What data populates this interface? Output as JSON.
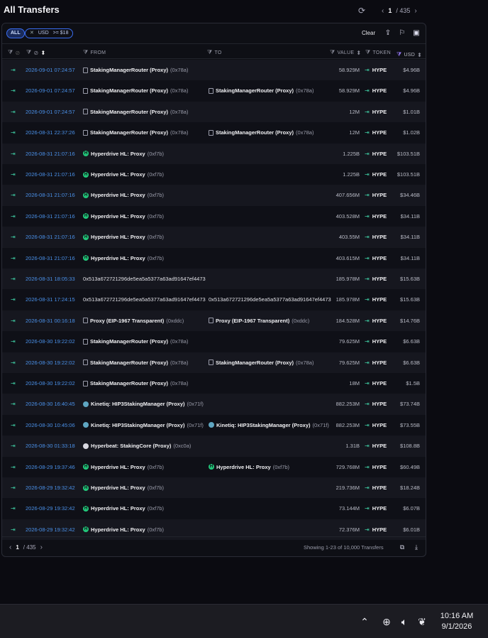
{
  "header": {
    "title": "All Transfers",
    "refresh_icon": "refresh-icon",
    "page_current": "1",
    "page_total": "/ 435"
  },
  "filters": {
    "all_label": "ALL",
    "usd_filter_label": "USD",
    "usd_filter_value": ">= $18",
    "clear_label": "Clear"
  },
  "columns": {
    "from": "FROM",
    "to": "TO",
    "value": "VALUE",
    "token": "TOKEN",
    "usd": "USD"
  },
  "rows": [
    {
      "time": "2026-09-01 07:24:57",
      "from_name": "StakingManagerRouter (Proxy)",
      "from_short": "(0x78a)",
      "from_icon": "doc",
      "to_name": "",
      "to_short": "",
      "to_icon": "",
      "value": "58.929M",
      "token": "HYPE",
      "usd": "$4.96B"
    },
    {
      "time": "2026-09-01 07:24:57",
      "from_name": "StakingManagerRouter (Proxy)",
      "from_short": "(0x78a)",
      "from_icon": "doc",
      "to_name": "StakingManagerRouter (Proxy)",
      "to_short": "(0x78a)",
      "to_icon": "doc",
      "value": "58.929M",
      "token": "HYPE",
      "usd": "$4.96B"
    },
    {
      "time": "2026-09-01 07:24:57",
      "from_name": "StakingManagerRouter (Proxy)",
      "from_short": "(0x78a)",
      "from_icon": "doc",
      "to_name": "",
      "to_short": "",
      "to_icon": "",
      "value": "12M",
      "token": "HYPE",
      "usd": "$1.01B"
    },
    {
      "time": "2026-08-31 22:37:26",
      "from_name": "StakingManagerRouter (Proxy)",
      "from_short": "(0x78a)",
      "from_icon": "doc",
      "to_name": "StakingManagerRouter (Proxy)",
      "to_short": "(0x78a)",
      "to_icon": "doc",
      "value": "12M",
      "token": "HYPE",
      "usd": "$1.02B"
    },
    {
      "time": "2026-08-31 21:07:16",
      "from_name": "Hyperdrive HL: Proxy",
      "from_short": "(0xf7b)",
      "from_icon": "hyper",
      "to_name": "",
      "to_short": "",
      "to_icon": "",
      "value": "1.225B",
      "token": "HYPE",
      "usd": "$103.51B"
    },
    {
      "time": "2026-08-31 21:07:16",
      "from_name": "Hyperdrive HL: Proxy",
      "from_short": "(0xf7b)",
      "from_icon": "hyper",
      "to_name": "",
      "to_short": "",
      "to_icon": "",
      "value": "1.225B",
      "token": "HYPE",
      "usd": "$103.51B"
    },
    {
      "time": "2026-08-31 21:07:16",
      "from_name": "Hyperdrive HL: Proxy",
      "from_short": "(0xf7b)",
      "from_icon": "hyper",
      "to_name": "",
      "to_short": "",
      "to_icon": "",
      "value": "407.656M",
      "token": "HYPE",
      "usd": "$34.46B"
    },
    {
      "time": "2026-08-31 21:07:16",
      "from_name": "Hyperdrive HL: Proxy",
      "from_short": "(0xf7b)",
      "from_icon": "hyper",
      "to_name": "",
      "to_short": "",
      "to_icon": "",
      "value": "403.528M",
      "token": "HYPE",
      "usd": "$34.11B"
    },
    {
      "time": "2026-08-31 21:07:16",
      "from_name": "Hyperdrive HL: Proxy",
      "from_short": "(0xf7b)",
      "from_icon": "hyper",
      "to_name": "",
      "to_short": "",
      "to_icon": "",
      "value": "403.55M",
      "token": "HYPE",
      "usd": "$34.11B"
    },
    {
      "time": "2026-08-31 21:07:16",
      "from_name": "Hyperdrive HL: Proxy",
      "from_short": "(0xf7b)",
      "from_icon": "hyper",
      "to_name": "",
      "to_short": "",
      "to_icon": "",
      "value": "403.615M",
      "token": "HYPE",
      "usd": "$34.11B"
    },
    {
      "time": "2026-08-31 18:05:33",
      "from_name": "",
      "from_short": "",
      "from_plain": "0x513a672721296de5ea5a5377a63ad91647ef4473",
      "from_icon": "",
      "to_name": "",
      "to_short": "",
      "to_icon": "",
      "value": "185.978M",
      "token": "HYPE",
      "usd": "$15.63B"
    },
    {
      "time": "2026-08-31 17:24:15",
      "from_name": "",
      "from_short": "",
      "from_plain": "0x513a672721296de5ea5a5377a63ad91647ef4473",
      "from_icon": "",
      "to_name": "",
      "to_short": "",
      "to_plain": "0x513a672721296de5ea5a5377a63ad91647ef4473",
      "to_icon": "",
      "value": "185.978M",
      "token": "HYPE",
      "usd": "$15.63B"
    },
    {
      "time": "2026-08-31 00:16:18",
      "from_name": "Proxy (EIP-1967 Transparent)",
      "from_short": "(0xddc)",
      "from_icon": "doc",
      "to_name": "Proxy (EIP-1967 Transparent)",
      "to_short": "(0xddc)",
      "to_icon": "doc",
      "value": "184.528M",
      "token": "HYPE",
      "usd": "$14.76B"
    },
    {
      "time": "2026-08-30 19:22:02",
      "from_name": "StakingManagerRouter (Proxy)",
      "from_short": "(0x78a)",
      "from_icon": "doc",
      "to_name": "",
      "to_short": "",
      "to_icon": "",
      "value": "79.625M",
      "token": "HYPE",
      "usd": "$6.63B"
    },
    {
      "time": "2026-08-30 19:22:02",
      "from_name": "StakingManagerRouter (Proxy)",
      "from_short": "(0x78a)",
      "from_icon": "doc",
      "to_name": "StakingManagerRouter (Proxy)",
      "to_short": "(0x78a)",
      "to_icon": "doc",
      "value": "79.625M",
      "token": "HYPE",
      "usd": "$6.63B"
    },
    {
      "time": "2026-08-30 19:22:02",
      "from_name": "StakingManagerRouter (Proxy)",
      "from_short": "(0x78a)",
      "from_icon": "doc",
      "to_name": "",
      "to_short": "",
      "to_icon": "",
      "value": "18M",
      "token": "HYPE",
      "usd": "$1.5B"
    },
    {
      "time": "2026-08-30 16:40:45",
      "from_name": "Kinetiq: HIP3StakingManager (Proxy)",
      "from_short": "(0x71f)",
      "from_icon": "kinetiq",
      "to_name": "",
      "to_short": "",
      "to_icon": "",
      "value": "882.253M",
      "token": "HYPE",
      "usd": "$73.74B"
    },
    {
      "time": "2026-08-30 10:45:06",
      "from_name": "Kinetiq: HIP3StakingManager (Proxy)",
      "from_short": "(0x71f)",
      "from_icon": "kinetiq",
      "to_name": "Kinetiq: HIP3StakingManager (Proxy)",
      "to_short": "(0x71f)",
      "to_icon": "kinetiq",
      "value": "882.253M",
      "token": "HYPE",
      "usd": "$73.55B"
    },
    {
      "time": "2026-08-30 01:33:18",
      "from_name": "Hyperbeat: StakingCore (Proxy)",
      "from_short": "(0xc0a)",
      "from_icon": "hyperbeat",
      "to_name": "",
      "to_short": "",
      "to_icon": "",
      "value": "1.31B",
      "token": "HYPE",
      "usd": "$108.8B"
    },
    {
      "time": "2026-08-29 19:37:46",
      "from_name": "Hyperdrive HL: Proxy",
      "from_short": "(0xf7b)",
      "from_icon": "hyper",
      "to_name": "Hyperdrive HL: Proxy",
      "to_short": "(0xf7b)",
      "to_icon": "hyper",
      "value": "729.768M",
      "token": "HYPE",
      "usd": "$60.49B"
    },
    {
      "time": "2026-08-29 19:32:42",
      "from_name": "Hyperdrive HL: Proxy",
      "from_short": "(0xf7b)",
      "from_icon": "hyper",
      "to_name": "",
      "to_short": "",
      "to_icon": "",
      "value": "219.736M",
      "token": "HYPE",
      "usd": "$18.24B"
    },
    {
      "time": "2026-08-29 19:32:42",
      "from_name": "Hyperdrive HL: Proxy",
      "from_short": "(0xf7b)",
      "from_icon": "hyper",
      "to_name": "",
      "to_short": "",
      "to_icon": "",
      "value": "73.144M",
      "token": "HYPE",
      "usd": "$6.07B"
    },
    {
      "time": "2026-08-29 19:32:42",
      "from_name": "Hyperdrive HL: Proxy",
      "from_short": "(0xf7b)",
      "from_icon": "hyper",
      "to_name": "",
      "to_short": "",
      "to_icon": "",
      "value": "72.376M",
      "token": "HYPE",
      "usd": "$6.01B"
    }
  ],
  "footer": {
    "page_current": "1",
    "page_total": "/ 435",
    "showing": "Showing 1-23 of 10,000 Transfers"
  },
  "taskbar": {
    "time": "10:16 AM",
    "date": "9/1/2026"
  }
}
